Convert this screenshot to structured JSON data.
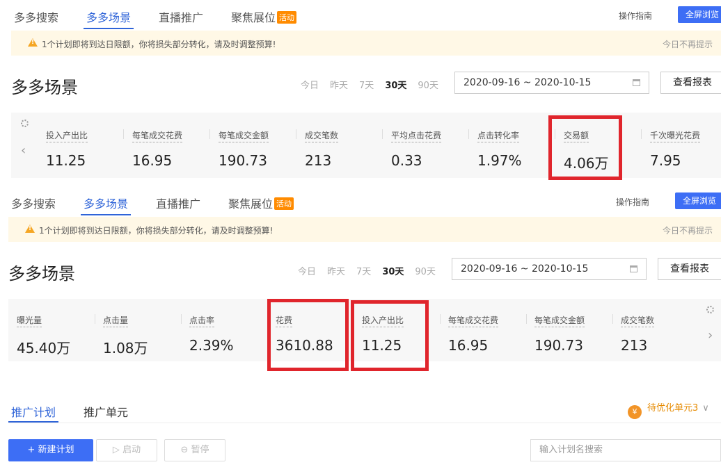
{
  "top": {
    "tabs": [
      "多多搜索",
      "多多场景",
      "直播推广",
      "聚焦展位"
    ],
    "activity_badge": "活动",
    "guide": "操作指南",
    "fullscreen": "全屏浏览",
    "warning": "1个计划即将到达日限额，你将损失部分转化，请及时调整预算!",
    "dismiss": "今日不再提示",
    "page_title": "多多场景",
    "ranges": [
      "今日",
      "昨天",
      "7天",
      "30天",
      "90天"
    ],
    "selected_range": "30天",
    "date_range": "2020-09-16 ~ 2020-10-15",
    "report_button": "查看报表",
    "metrics": [
      {
        "label": "投入产出比",
        "value": "11.25"
      },
      {
        "label": "每笔成交花费",
        "value": "16.95"
      },
      {
        "label": "每笔成交金额",
        "value": "190.73"
      },
      {
        "label": "成交笔数",
        "value": "213"
      },
      {
        "label": "平均点击花费",
        "value": "0.33"
      },
      {
        "label": "点击转化率",
        "value": "1.97%"
      },
      {
        "label": "交易额",
        "value": "4.06万"
      },
      {
        "label": "千次曝光花费",
        "value": "7.95"
      }
    ],
    "highlight_color": "#e0252c"
  },
  "bottom": {
    "tabs": [
      "多多搜索",
      "多多场景",
      "直播推广",
      "聚焦展位"
    ],
    "activity_badge": "活动",
    "guide": "操作指南",
    "fullscreen": "全屏浏览",
    "warning": "1个计划即将到达日限额，你将损失部分转化，请及时调整预算!",
    "dismiss": "今日不再提示",
    "page_title": "多多场景",
    "ranges": [
      "今日",
      "昨天",
      "7天",
      "30天",
      "90天"
    ],
    "selected_range": "30天",
    "date_range": "2020-09-16 ~ 2020-10-15",
    "report_button": "查看报表",
    "metrics": [
      {
        "label": "曝光量",
        "value": "45.40万"
      },
      {
        "label": "点击量",
        "value": "1.08万"
      },
      {
        "label": "点击率",
        "value": "2.39%"
      },
      {
        "label": "花费",
        "value": "3610.88"
      },
      {
        "label": "投入产出比",
        "value": "11.25"
      },
      {
        "label": "每笔成交花费",
        "value": "16.95"
      },
      {
        "label": "每笔成交金额",
        "value": "190.73"
      },
      {
        "label": "成交笔数",
        "value": "213"
      }
    ],
    "subtabs": [
      "推广计划",
      "推广单元"
    ],
    "optimize": "待优化单元3",
    "new_plan": "+ 新建计划",
    "start": "启动",
    "pause": "暂停",
    "search_placeholder": "输入计划名搜索"
  },
  "accent_color": "#2f64d8"
}
